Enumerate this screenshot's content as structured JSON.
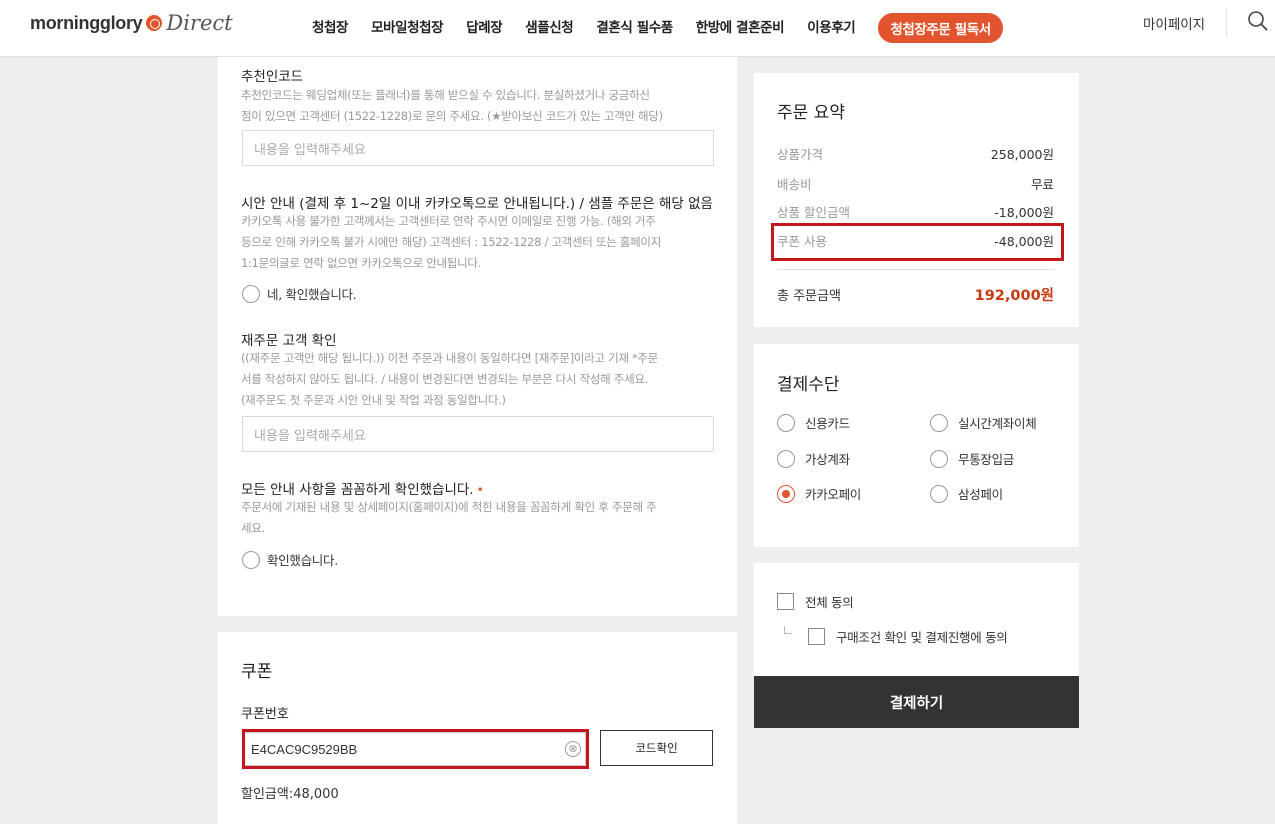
{
  "header": {
    "logo_text": "morningglory",
    "logo_script": "Direct",
    "nav": [
      "청첩장",
      "모바일청첩장",
      "답례장",
      "샘플신청",
      "결혼식 필수품",
      "한방에 결혼준비",
      "이용후기"
    ],
    "cta": "청첩장주문 필독서",
    "mypage": "마이페이지"
  },
  "form": {
    "referral": {
      "title": "추천인코드",
      "desc": [
        "추천인코드는 웨딩업체(또는 플래너)를 통해 받으실 수 있습니다. 분실하셨거나 궁금하신",
        "점이 있으면 고객센터 (1522-1228)로 문의 주세요. (★받아보신 코드가 있는 고객만 해당)"
      ],
      "placeholder": "내용을 입력해주세요"
    },
    "draft": {
      "title": "시안 안내 (결제 후 1~2일 이내 카카오톡으로 안내됩니다.) / 샘플 주문은 해당 없음",
      "desc": [
        "카카오톡 사용 불가한 고객께서는 고객센터로 연락 주시면 이메일로 진행 가능. (해외 거주",
        "등으로 인해 카카오톡 불가 시에만 해당) 고객센터 : 1522-1228 / 고객센터 또는 홈페이지",
        "1:1문의글로 연락 없으면 카카오톡으로 안내됩니다."
      ],
      "option": "네, 확인했습니다."
    },
    "reorder": {
      "title": "재주문 고객 확인",
      "desc": [
        "((재주문 고객만 해당 됩니다.)) 이전 주문과 내용이 동일하다면 [재주문]이라고 기재 *주문",
        "서를 작성하지 않아도 됩니다. / 내용이 변경된다면 변경되는 부분은 다시 작성해 주세요.",
        "(재주문도 첫 주문과 시안 안내 및 작업 과정 동일합니다.)"
      ],
      "placeholder": "내용을 입력해주세요"
    },
    "confirm": {
      "title": "모든 안내 사항을 꼼꼼하게 확인했습니다.",
      "required_mark": "•",
      "desc": [
        "주문서에 기재된 내용 및 상세페이지(홈페이지)에 적힌 내용을 꼼꼼하게 확인 후 주문해 주",
        "세요."
      ],
      "option": "확인했습니다."
    }
  },
  "coupon": {
    "title": "쿠폰",
    "label": "쿠폰번호",
    "value": "E4CAC9C9529BB",
    "clear_icon": "⊗",
    "button": "코드확인",
    "discount_label": "할인금액:",
    "discount_value": "48,000"
  },
  "summary": {
    "title": "주문 요약",
    "rows": [
      {
        "label": "상품가격",
        "value": "258,000원"
      },
      {
        "label": "배송비",
        "value": "무료"
      },
      {
        "label": "상품 할인금액",
        "value": "-18,000원"
      },
      {
        "label": "쿠폰 사용",
        "value": "-48,000원"
      }
    ],
    "total_label": "총 주문금액",
    "total_value": "192,000원"
  },
  "payment": {
    "title": "결제수단",
    "options": [
      {
        "label": "신용카드",
        "selected": false
      },
      {
        "label": "실시간계좌이체",
        "selected": false
      },
      {
        "label": "가상계좌",
        "selected": false
      },
      {
        "label": "무통장입금",
        "selected": false
      },
      {
        "label": "카카오페이",
        "selected": true
      },
      {
        "label": "삼성페이",
        "selected": false
      }
    ]
  },
  "agreement": {
    "all": "전체 동의",
    "purchase": "구매조건 확인 및 결제진행에 동의"
  },
  "pay_button": "결제하기",
  "colors": {
    "accent": "#e2542d",
    "highlight": "#c4161c",
    "total": "#c73a12",
    "button_dark": "#333333"
  }
}
